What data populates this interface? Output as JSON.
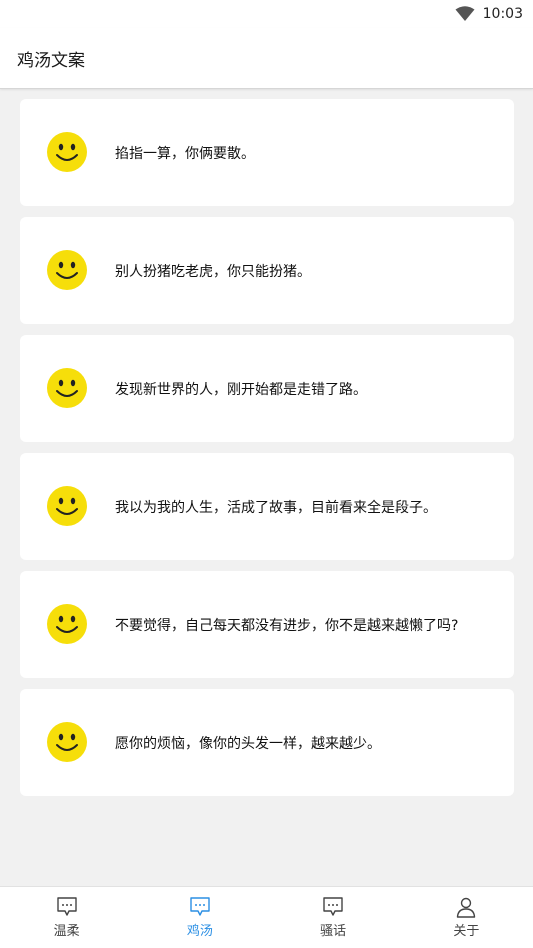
{
  "status_bar": {
    "time": "10:03",
    "icons": [
      "wifi-icon"
    ]
  },
  "header": {
    "title": "鸡汤文案"
  },
  "cards": [
    {
      "icon": "smiley-icon",
      "text": "掐指一算，你俩要散。"
    },
    {
      "icon": "smiley-icon",
      "text": "别人扮猪吃老虎，你只能扮猪。"
    },
    {
      "icon": "smiley-icon",
      "text": "发现新世界的人，刚开始都是走错了路。"
    },
    {
      "icon": "smiley-icon",
      "text": "我以为我的人生，活成了故事，目前看来全是段子。"
    },
    {
      "icon": "smiley-icon",
      "text": "不要觉得，自己每天都没有进步，你不是越来越懒了吗?"
    },
    {
      "icon": "smiley-icon",
      "text": "愿你的烦恼，像你的头发一样，越来越少。"
    }
  ],
  "bottom_nav": {
    "items": [
      {
        "label": "温柔",
        "icon": "chat-bubble-icon",
        "active": false
      },
      {
        "label": "鸡汤",
        "icon": "chat-bubble-icon",
        "active": true
      },
      {
        "label": "骚话",
        "icon": "chat-bubble-icon",
        "active": false
      },
      {
        "label": "关于",
        "icon": "person-icon",
        "active": false
      }
    ]
  },
  "colors": {
    "accent": "#2b8fe4",
    "smiley": "#f6de0a",
    "background": "#f1f1f1"
  }
}
